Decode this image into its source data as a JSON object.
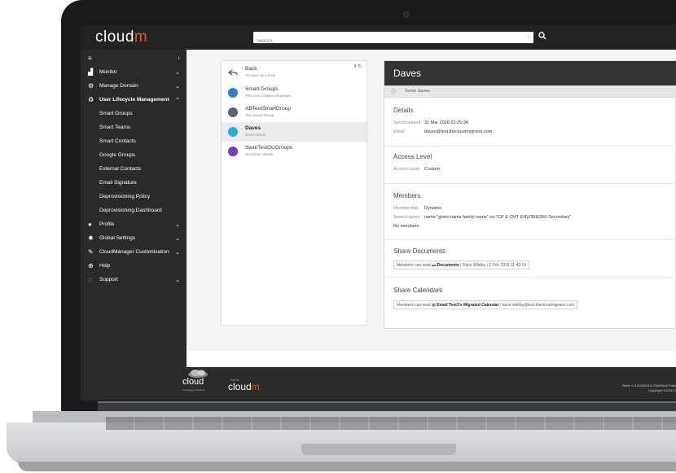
{
  "app": {
    "logo_text": "cloud",
    "logo_accent": "m",
    "brand_color": "#e8551d"
  },
  "search": {
    "placeholder": "Search..."
  },
  "sidebar": {
    "items": [
      {
        "label": "Monitor",
        "icon": "chart-icon",
        "has_chevron": true
      },
      {
        "label": "Manage Domain",
        "icon": "cogs-icon",
        "has_chevron": true
      },
      {
        "label": "User Lifecycle Management",
        "icon": "recycle-icon",
        "expanded": true
      },
      {
        "label": "Smart Groups"
      },
      {
        "label": "Smart Teams"
      },
      {
        "label": "Smart Contacts"
      },
      {
        "label": "Google Groups"
      },
      {
        "label": "External Contacts"
      },
      {
        "label": "Email Signature"
      },
      {
        "label": "Deprovisioning Policy"
      },
      {
        "label": "Deprovisioning Dashboard"
      },
      {
        "label": "Profile",
        "icon": "user-icon",
        "has_chevron": true
      },
      {
        "label": "Global Settings",
        "icon": "gear-icon",
        "has_chevron": true
      },
      {
        "label": "CloudManager Customisation",
        "icon": "edit-icon",
        "has_chevron": true
      },
      {
        "label": "Help",
        "icon": "lifebuoy-icon"
      },
      {
        "label": "Support",
        "icon": "chat-icon",
        "has_chevron": true
      }
    ]
  },
  "list": {
    "items": [
      {
        "title": "Back",
        "subtitle": "Go back up a level",
        "kind": "back"
      },
      {
        "title": "Smart Groups",
        "subtitle": "This unit contains all groups",
        "color": "#2a7fd4"
      },
      {
        "title": "ABTestSmartGroup",
        "subtitle": "Test Smart Group",
        "color": "#5b6470"
      },
      {
        "title": "Daves",
        "subtitle": "Some daves",
        "color": "#27a9e1",
        "active": true
      },
      {
        "title": "SeanTestOUGroups",
        "subtitle": "No further details",
        "color": "#7a3bb5"
      }
    ]
  },
  "detail": {
    "title": "Daves",
    "description": "Some daves",
    "details_heading": "Details",
    "synchronised_label": "Synchronised",
    "synchronised_value": "31 Mar 2020 22:25:34",
    "email_label": "Email",
    "email_value": "daves@test.thecloudmigrator.com",
    "access_heading": "Access Level",
    "access_label": "Access Level",
    "access_value": "Custom",
    "members_heading": "Members",
    "membership_label": "Membership",
    "membership_value": "Dynamic",
    "query_label": "Search query",
    "query_value": "name:\"given name family name\" ou:\"CP & CMT ENV/366/366-Secondary\"",
    "no_members": "No members",
    "share_docs_heading": "Share Documents",
    "share_docs_prefix": "Members can read",
    "share_docs_bold": "Documents",
    "share_docs_suffix": "| Dave Whitby | 1 Feb 2019 11:42:16",
    "share_cal_heading": "Share Calendars",
    "share_cal_prefix": "Members can read",
    "share_cal_bold": "Email Test3's Migrated Calendar",
    "share_cal_suffix": "| dave.whitby@test.thecloudmigrator.com"
  },
  "footer": {
    "logo1": "cloud",
    "logo1_sub": "technology solutions",
    "part_of": "Part of",
    "logo2": "cloud",
    "logo2_accent": "m",
    "build": "Build: 0.9.20200319-7f3b63bc2 Publi",
    "copyright": "Copyright ©2020 C"
  }
}
